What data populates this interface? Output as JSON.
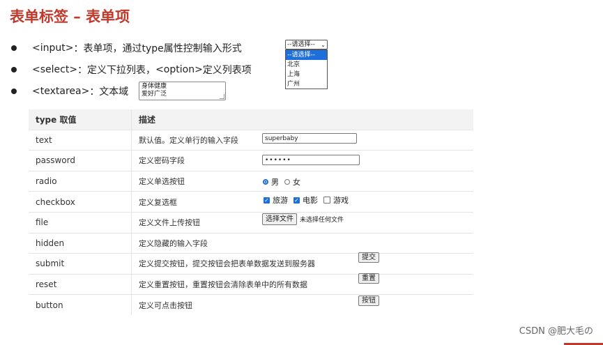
{
  "title": "表单标签 – 表单项",
  "bullets": [
    {
      "code": "<input>",
      "text": "：表单项，通过type属性控制输入形式"
    },
    {
      "code": "<select>",
      "text": "：定义下拉列表，",
      "code2": "<option>",
      "text2": " 定义列表项"
    },
    {
      "code": "<textarea>",
      "text": "：文本域"
    }
  ],
  "textarea_demo": {
    "line1": "身体健康",
    "line2": "爱好广泛"
  },
  "select_demo": {
    "value": "--请选择--",
    "arrow": "⌄",
    "options": [
      "--请选择--",
      "北京",
      "上海",
      "广州"
    ]
  },
  "table": {
    "headers": [
      "type 取值",
      "描述"
    ],
    "rows": [
      {
        "type": "text",
        "desc": "默认值。定义单行的输入字段"
      },
      {
        "type": "password",
        "desc": "定义密码字段"
      },
      {
        "type": "radio",
        "desc": "定义单选按钮"
      },
      {
        "type": "checkbox",
        "desc": "定义复选框"
      },
      {
        "type": "file",
        "desc": "定义文件上传按钮"
      },
      {
        "type": "hidden",
        "desc": "定义隐藏的输入字段"
      },
      {
        "type": "submit",
        "desc": "定义提交按钮，提交按钮会把表单数据发送到服务器"
      },
      {
        "type": "reset",
        "desc": "定义重置按钮，重置按钮会清除表单中的所有数据"
      },
      {
        "type": "button",
        "desc": "定义可点击按钮"
      }
    ]
  },
  "demos": {
    "text_value": "superbaby",
    "password_value": "••••••",
    "radio": [
      "男",
      "女"
    ],
    "checkbox": [
      "旅游",
      "电影",
      "游戏"
    ],
    "check_mark": "✓",
    "file_button": "选择文件",
    "file_note": "未选择任何文件",
    "submit_label": "提交",
    "reset_label": "重置",
    "button_label": "按钮"
  },
  "watermark": "CSDN @肥大毛の",
  "colors": {
    "title": "#c0392b",
    "accent": "#1e6fd9"
  }
}
